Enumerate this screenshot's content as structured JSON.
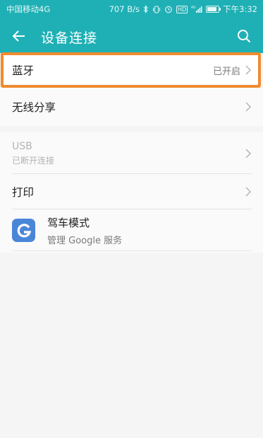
{
  "status_bar": {
    "carrier": "中国移动4G",
    "net_speed": "707 B/s",
    "hd_badge": "HD",
    "network_type": "4G",
    "time": "下午3:32"
  },
  "app_bar": {
    "title": "设备连接"
  },
  "items": {
    "bluetooth": {
      "label": "蓝牙",
      "value": "已开启"
    },
    "wireless_share": {
      "label": "无线分享"
    },
    "usb": {
      "label": "USB",
      "sub": "已断开连接"
    },
    "print": {
      "label": "打印"
    },
    "driving_mode": {
      "label": "驾车模式",
      "sub": "管理 Google 服务"
    }
  },
  "colors": {
    "accent": "#1fb0b5",
    "highlight_border": "#ef8b2f",
    "google_icon": "#4a86d8"
  }
}
